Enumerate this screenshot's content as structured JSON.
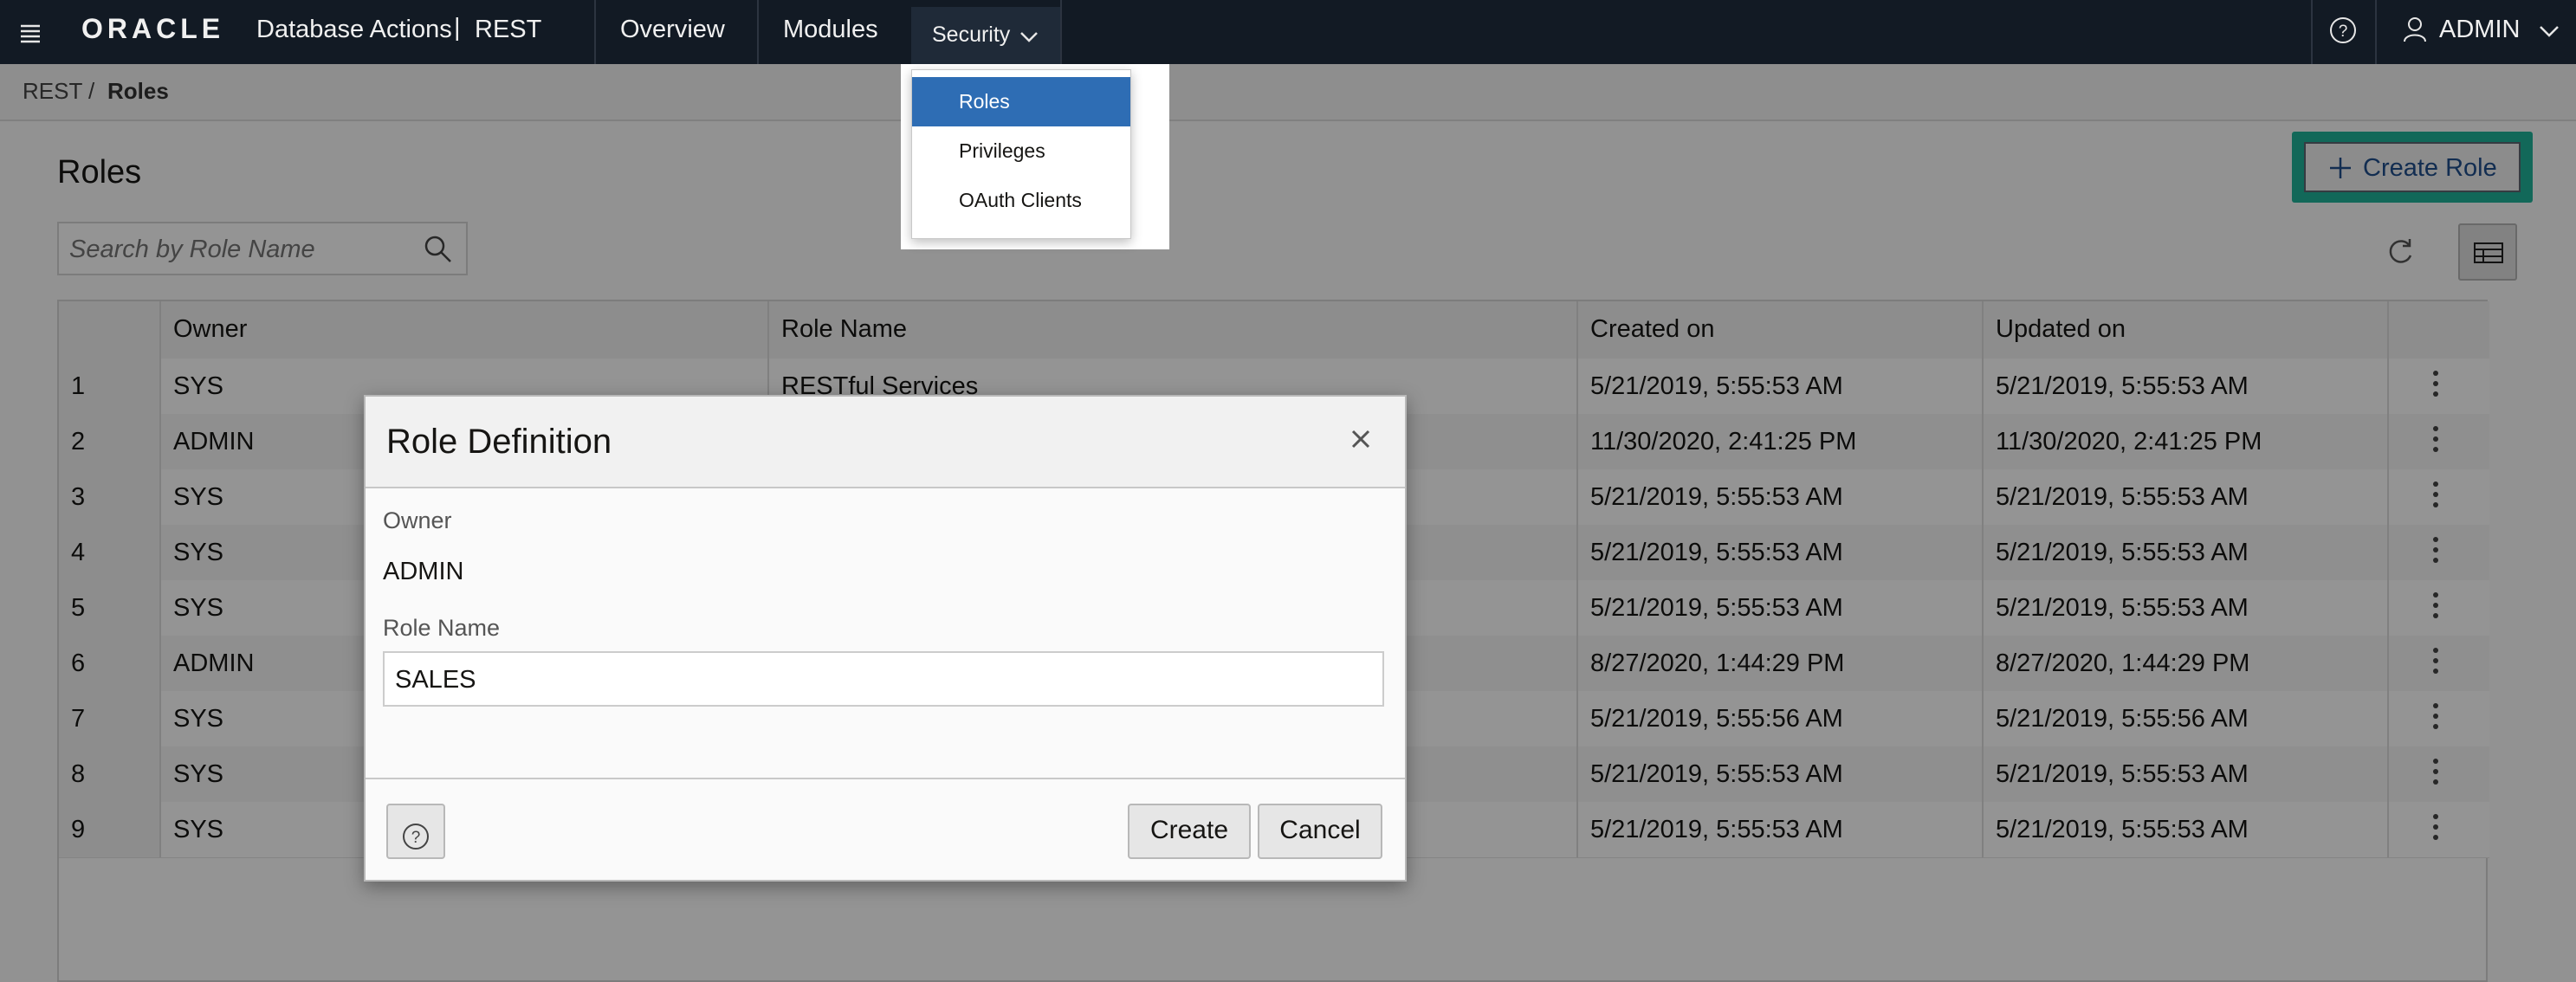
{
  "topbar": {
    "brand": "ORACLE",
    "app_name": "Database Actions",
    "separator": "|",
    "section": "REST",
    "nav": [
      {
        "label": "Overview"
      },
      {
        "label": "Modules"
      },
      {
        "label": "Security"
      }
    ],
    "user": "ADMIN"
  },
  "security_menu": {
    "items": [
      {
        "label": "Roles",
        "selected": true
      },
      {
        "label": "Privileges",
        "selected": false
      },
      {
        "label": "OAuth Clients",
        "selected": false
      }
    ]
  },
  "breadcrumb": {
    "root": "REST",
    "sep": "/",
    "current": "Roles"
  },
  "page": {
    "title": "Roles",
    "create_button": "Create Role",
    "search_placeholder": "Search by Role Name"
  },
  "table": {
    "columns": [
      "",
      "Owner",
      "Role Name",
      "Created on",
      "Updated on",
      ""
    ],
    "rows": [
      {
        "num": "1",
        "owner": "SYS",
        "role": "RESTful Services",
        "created": "5/21/2019, 5:55:53 AM",
        "updated": "5/21/2019, 5:55:53 AM"
      },
      {
        "num": "2",
        "owner": "ADMIN",
        "role": "",
        "created": "11/30/2020, 2:41:25 PM",
        "updated": "11/30/2020, 2:41:25 PM"
      },
      {
        "num": "3",
        "owner": "SYS",
        "role": "",
        "created": "5/21/2019, 5:55:53 AM",
        "updated": "5/21/2019, 5:55:53 AM"
      },
      {
        "num": "4",
        "owner": "SYS",
        "role": "",
        "created": "5/21/2019, 5:55:53 AM",
        "updated": "5/21/2019, 5:55:53 AM"
      },
      {
        "num": "5",
        "owner": "SYS",
        "role": "",
        "created": "5/21/2019, 5:55:53 AM",
        "updated": "5/21/2019, 5:55:53 AM"
      },
      {
        "num": "6",
        "owner": "ADMIN",
        "role": "",
        "created": "8/27/2020, 1:44:29 PM",
        "updated": "8/27/2020, 1:44:29 PM"
      },
      {
        "num": "7",
        "owner": "SYS",
        "role": "",
        "created": "5/21/2019, 5:55:56 AM",
        "updated": "5/21/2019, 5:55:56 AM"
      },
      {
        "num": "8",
        "owner": "SYS",
        "role": "",
        "created": "5/21/2019, 5:55:53 AM",
        "updated": "5/21/2019, 5:55:53 AM"
      },
      {
        "num": "9",
        "owner": "SYS",
        "role": "",
        "created": "5/21/2019, 5:55:53 AM",
        "updated": "5/21/2019, 5:55:53 AM"
      }
    ]
  },
  "dialog": {
    "title": "Role Definition",
    "owner_label": "Owner",
    "owner_value": "ADMIN",
    "role_label": "Role Name",
    "role_value": "SALES",
    "create": "Create",
    "cancel": "Cancel"
  },
  "colors": {
    "topbar": "#121a24",
    "menu_selected": "#2e6db4",
    "create_role_highlight": "#1fb39a",
    "link_blue": "#1f4e8c"
  },
  "icons": [
    "hamburger-icon",
    "help-icon",
    "user-icon",
    "chevron-down-icon",
    "search-icon",
    "refresh-icon",
    "grid-view-icon",
    "kebab-icon",
    "close-icon",
    "plus-icon"
  ]
}
